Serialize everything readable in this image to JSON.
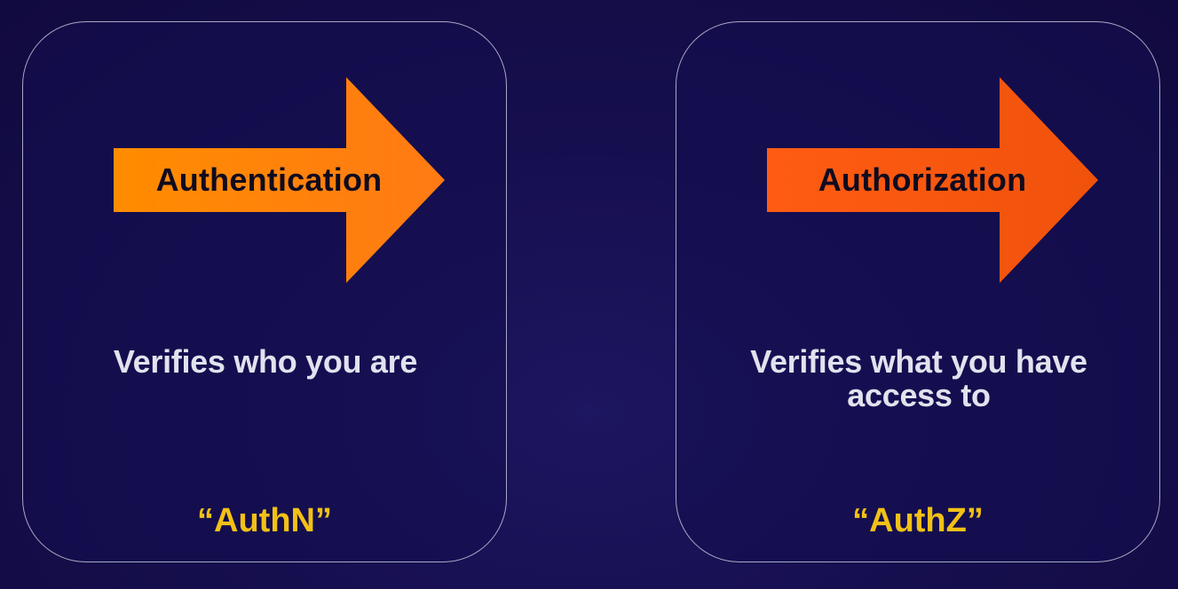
{
  "cards": [
    {
      "arrow_label": "Authentication",
      "description": "Verifies who you are",
      "nickname": "“AuthN”",
      "arrow_colors": [
        "#ff8a00",
        "#ff7a10"
      ]
    },
    {
      "arrow_label": "Authorization",
      "description": "Verifies what you have access to",
      "nickname": "“AuthZ”",
      "arrow_colors": [
        "#ff5a14",
        "#e94f0c"
      ]
    }
  ],
  "colors": {
    "nickname": "#f2c115",
    "description": "#e2e2ee",
    "card_border": "#dcdceb"
  }
}
